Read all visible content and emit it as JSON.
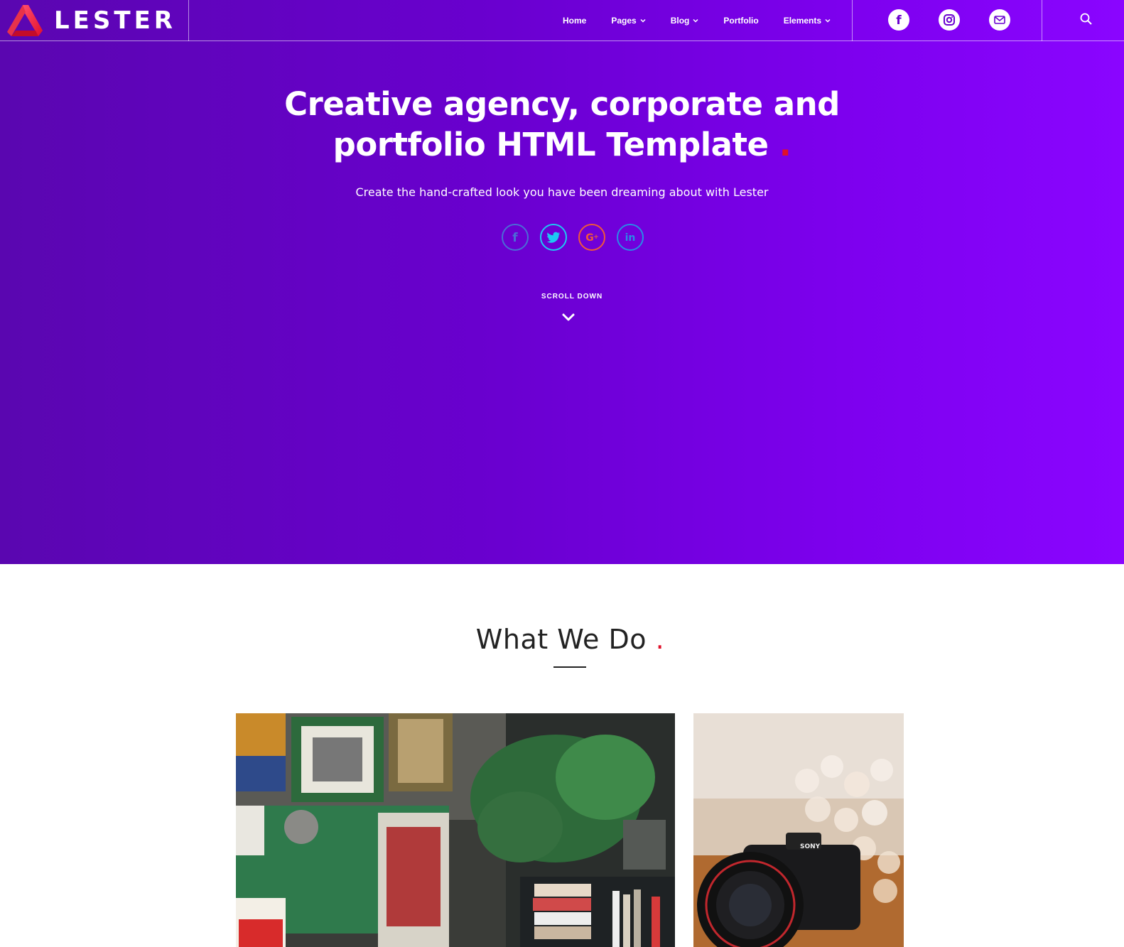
{
  "brand": {
    "name": "LESTER"
  },
  "nav": {
    "items": [
      {
        "label": "Home",
        "dropdown": false
      },
      {
        "label": "Pages",
        "dropdown": true
      },
      {
        "label": "Blog",
        "dropdown": true
      },
      {
        "label": "Portfolio",
        "dropdown": false
      },
      {
        "label": "Elements",
        "dropdown": true
      }
    ],
    "social_icons": [
      "facebook-icon",
      "instagram-icon",
      "mail-icon"
    ],
    "search_icon": "search-icon"
  },
  "hero": {
    "title_line1": "Creative agency, corporate and",
    "title_line2": "portfolio HTML Template",
    "title_dot": ".",
    "subtitle": "Create the hand-crafted look you have been dreaming about with Lester",
    "social_icons": [
      "facebook-icon",
      "twitter-icon",
      "google-plus-icon",
      "linkedin-icon"
    ],
    "scroll_label": "SCROLL DOWN"
  },
  "section": {
    "title": "What We Do",
    "title_dot": "."
  },
  "colors": {
    "hero_gradient_start": "#5a06b0",
    "hero_gradient_end": "#8a05ff",
    "accent_red": "#e0102a",
    "facebook_ring": "#4b6cd6",
    "twitter_ring": "#1dc9f2",
    "google_ring": "#f0583a",
    "linkedin_ring": "#2a8ae6"
  }
}
